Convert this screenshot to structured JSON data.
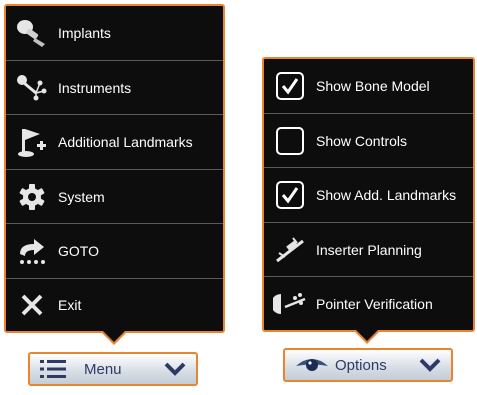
{
  "menu": {
    "items": [
      {
        "label": "Implants",
        "icon": "implant-icon"
      },
      {
        "label": "Instruments",
        "icon": "instruments-icon"
      },
      {
        "label": "Additional Landmarks",
        "icon": "add-landmark-flag-icon"
      },
      {
        "label": "System",
        "icon": "gear-icon"
      },
      {
        "label": "GOTO",
        "icon": "goto-icon"
      },
      {
        "label": "Exit",
        "icon": "close-icon"
      }
    ],
    "button_label": "Menu"
  },
  "options": {
    "items": [
      {
        "label": "Show Bone Model",
        "checked": true
      },
      {
        "label": "Show Controls",
        "checked": false
      },
      {
        "label": "Show Add. Landmarks",
        "checked": true
      },
      {
        "label": "Inserter Planning",
        "icon": "inserter-planning-icon"
      },
      {
        "label": "Pointer Verification",
        "icon": "pointer-verification-icon"
      }
    ],
    "button_label": "Options"
  },
  "colors": {
    "panel_bg": "#0d0d0d",
    "accent": "#e8852e",
    "button_text": "#2d3a66"
  }
}
